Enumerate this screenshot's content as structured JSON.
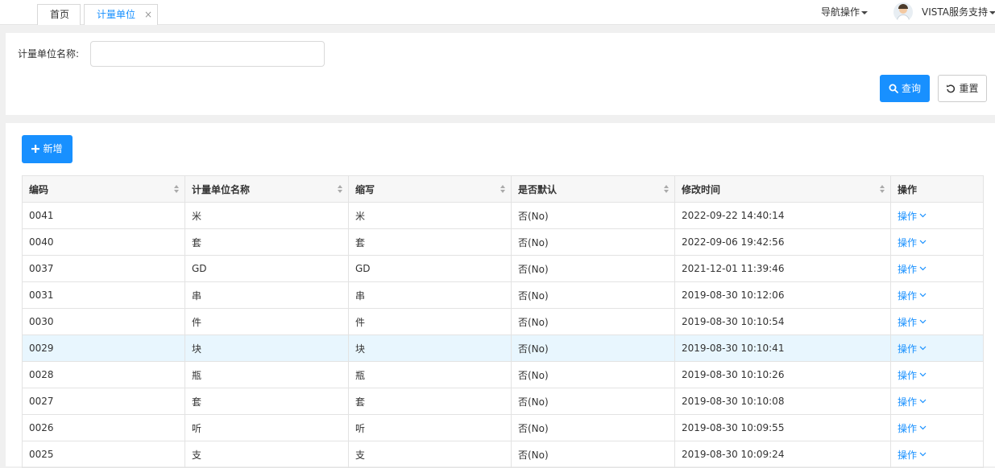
{
  "tabs": [
    {
      "label": "首页",
      "active": false
    },
    {
      "label": "计量单位",
      "active": true,
      "close": "×"
    }
  ],
  "header": {
    "nav_label": "导航操作",
    "user_name": "VISTA服务支持"
  },
  "search": {
    "field_label": "计量单位名称:",
    "field_value": "",
    "field_placeholder": "",
    "query_label": "查询",
    "reset_label": "重置"
  },
  "toolbar": {
    "add_label": "新增"
  },
  "table": {
    "columns": [
      "编码",
      "计量单位名称",
      "缩写",
      "是否默认",
      "修改时间",
      "操作"
    ],
    "rows": [
      {
        "code": "0041",
        "name": "米",
        "abbr": "米",
        "default": "否(No)",
        "modified": "2022-09-22 14:40:14",
        "action": "操作"
      },
      {
        "code": "0040",
        "name": "套",
        "abbr": "套",
        "default": "否(No)",
        "modified": "2022-09-06 19:42:56",
        "action": "操作"
      },
      {
        "code": "0037",
        "name": "GD",
        "abbr": "GD",
        "default": "否(No)",
        "modified": "2021-12-01 11:39:46",
        "action": "操作"
      },
      {
        "code": "0031",
        "name": "串",
        "abbr": "串",
        "default": "否(No)",
        "modified": "2019-08-30 10:12:06",
        "action": "操作"
      },
      {
        "code": "0030",
        "name": "件",
        "abbr": "件",
        "default": "否(No)",
        "modified": "2019-08-30 10:10:54",
        "action": "操作"
      },
      {
        "code": "0029",
        "name": "块",
        "abbr": "块",
        "default": "否(No)",
        "modified": "2019-08-30 10:10:41",
        "action": "操作"
      },
      {
        "code": "0028",
        "name": "瓶",
        "abbr": "瓶",
        "default": "否(No)",
        "modified": "2019-08-30 10:10:26",
        "action": "操作"
      },
      {
        "code": "0027",
        "name": "套",
        "abbr": "套",
        "default": "否(No)",
        "modified": "2019-08-30 10:10:08",
        "action": "操作"
      },
      {
        "code": "0026",
        "name": "听",
        "abbr": "听",
        "default": "否(No)",
        "modified": "2019-08-30 10:09:55",
        "action": "操作"
      },
      {
        "code": "0025",
        "name": "支",
        "abbr": "支",
        "default": "否(No)",
        "modified": "2019-08-30 10:09:24",
        "action": "操作"
      }
    ]
  },
  "colors": {
    "accent": "#1890ff",
    "highlight_row": "#e8f6fe"
  }
}
